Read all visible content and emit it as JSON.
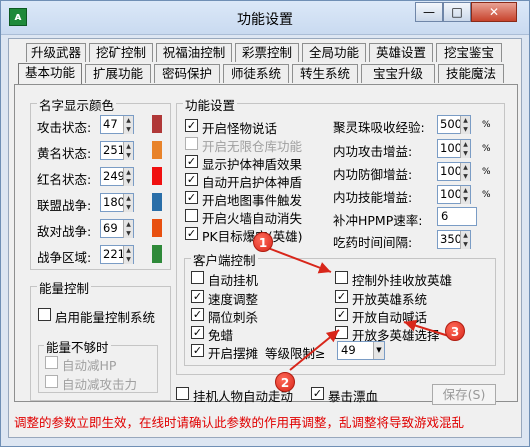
{
  "window": {
    "title": "功能设置",
    "icon_glyph": "ᴀ",
    "min_glyph": "—",
    "max_glyph": "□",
    "close_glyph": "✕"
  },
  "tabs_row1": [
    "升级武器",
    "挖矿控制",
    "祝福油控制",
    "彩票控制",
    "全局功能",
    "英雄设置",
    "挖宝鉴宝"
  ],
  "tabs_row2": [
    "基本功能",
    "扩展功能",
    "密码保护",
    "师徒系统",
    "转生系统",
    "宝宝升级",
    "技能魔法"
  ],
  "active_tab": "基本功能",
  "name_colors": {
    "title": "名字显示颜色",
    "rows": [
      {
        "label": "攻击状态:",
        "value": "47",
        "color": "#b03838"
      },
      {
        "label": "黄名状态:",
        "value": "251",
        "color": "#e8832a"
      },
      {
        "label": "红名状态:",
        "value": "249",
        "color": "#f01010"
      },
      {
        "label": "联盟战争:",
        "value": "180",
        "color": "#2a6ea8"
      },
      {
        "label": "敌对战争:",
        "value": "69",
        "color": "#e85010"
      },
      {
        "label": "战争区域:",
        "value": "221",
        "color": "#2f8a3a"
      }
    ]
  },
  "energy": {
    "title": "能量控制",
    "enable_label": "启用能量控制系统",
    "enable_checked": false,
    "sub_title": "能量不够时",
    "auto_hp_label": "自动减HP",
    "auto_atk_label": "自动减攻击力"
  },
  "features": {
    "title": "功能设置",
    "checks": [
      {
        "label": "开启怪物说话",
        "checked": true,
        "disabled": false
      },
      {
        "label": "开启无限仓库功能",
        "checked": false,
        "disabled": true
      },
      {
        "label": "显示护体神盾效果",
        "checked": true,
        "disabled": false
      },
      {
        "label": "自动开启护体神盾",
        "checked": true,
        "disabled": false
      },
      {
        "label": "开启地图事件触发",
        "checked": true,
        "disabled": false
      },
      {
        "label": "开启火墙自动消失",
        "checked": false,
        "disabled": false
      },
      {
        "label": "PK目标爆宝(英雄)",
        "checked": true,
        "disabled": false
      }
    ],
    "params": [
      {
        "label": "聚灵珠吸收经验:",
        "value": "500",
        "unit": "%"
      },
      {
        "label": "内功攻击增益:",
        "value": "100",
        "unit": "%"
      },
      {
        "label": "内功防御增益:",
        "value": "100",
        "unit": "%"
      },
      {
        "label": "内功技能增益:",
        "value": "100",
        "unit": "%"
      },
      {
        "label": "补冲HPMP速率:",
        "value": "6",
        "unit": ""
      },
      {
        "label": "吃药时间间隔:",
        "value": "350",
        "unit": ""
      }
    ]
  },
  "client": {
    "title": "客户端控制",
    "left": [
      {
        "label": "自动挂机",
        "checked": false
      },
      {
        "label": "速度调整",
        "checked": true
      },
      {
        "label": "隔位刺杀",
        "checked": true
      },
      {
        "label": "免蜡",
        "checked": true
      },
      {
        "label": "开启摆摊",
        "checked": true
      }
    ],
    "right": [
      {
        "label": "控制外挂收放英雄",
        "checked": false
      },
      {
        "label": "开放英雄系统",
        "checked": true
      },
      {
        "label": "开放自动喊话",
        "checked": true
      },
      {
        "label": "开放多英雄选择",
        "checked": false
      }
    ],
    "level_label": "等级限制≥",
    "level_value": "49"
  },
  "bottom": {
    "auto_walk_label": "挂机人物自动走动",
    "auto_walk_checked": false,
    "crit_label": "暴击漂血",
    "crit_checked": true,
    "save_label": "保存(S)"
  },
  "footer_text": "调整的参数立即生效，在线时请确认此参数的作用再调整，乱调整将导致游戏混乱",
  "annotations": [
    "1",
    "2",
    "3"
  ],
  "colors": {
    "accent_red": "#e00000",
    "badge_red": "#d8261a",
    "title_bg": "#c9daf0"
  }
}
